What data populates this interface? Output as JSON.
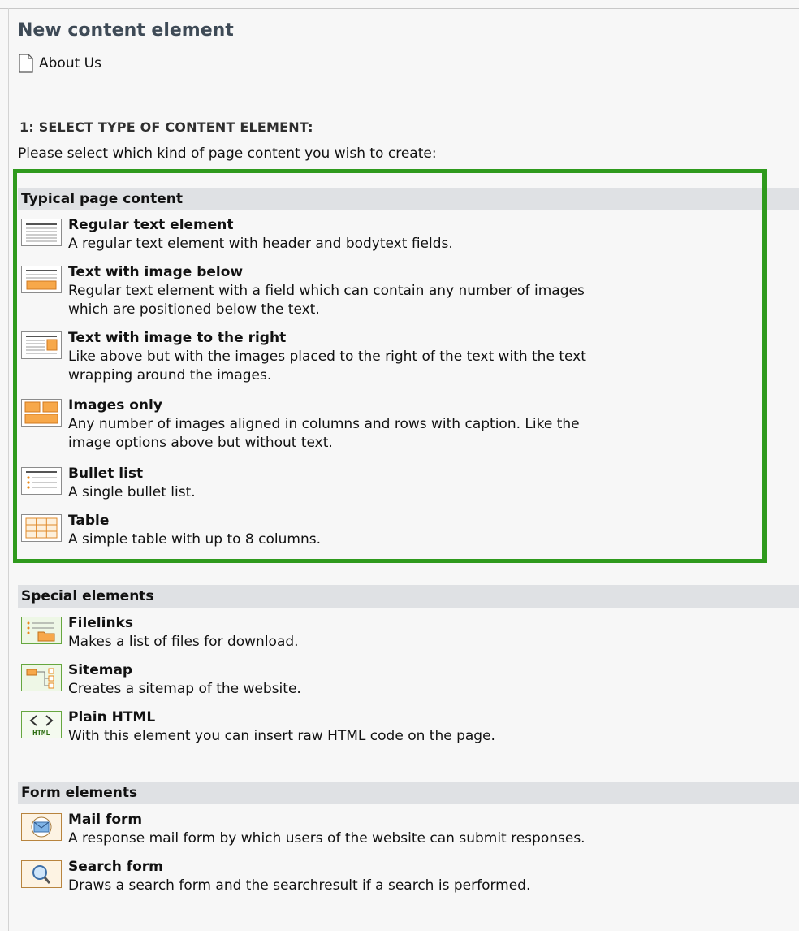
{
  "header": {
    "title": "New content element",
    "page_ref": "About Us",
    "step": "1: SELECT TYPE OF CONTENT ELEMENT:",
    "intro": "Please select which kind of page content you wish to create:"
  },
  "sections": {
    "typical": {
      "label": "Typical page content",
      "items": [
        {
          "name": "Regular text element",
          "desc": [
            "A regular text element with header and bodytext fields."
          ],
          "icon": "text-element-icon"
        },
        {
          "name": "Text with image below",
          "desc": [
            "Regular text element with a field which can contain any number of images",
            "which are positioned below the text."
          ],
          "icon": "text-image-below-icon"
        },
        {
          "name": "Text with image to the right",
          "desc": [
            "Like above but with the images placed to the right of the text with the text",
            "wrapping around the images."
          ],
          "icon": "text-image-right-icon"
        },
        {
          "name": "Images only",
          "desc": [
            "Any number of images aligned in columns and rows with caption. Like the",
            "image options above but without text."
          ],
          "icon": "images-only-icon"
        },
        {
          "name": "Bullet list",
          "desc": [
            "A single bullet list."
          ],
          "icon": "bullet-list-icon"
        },
        {
          "name": "Table",
          "desc": [
            "A simple table with up to 8 columns."
          ],
          "icon": "table-icon"
        }
      ]
    },
    "special": {
      "label": "Special elements",
      "items": [
        {
          "name": "Filelinks",
          "desc": [
            "Makes a list of files for download."
          ],
          "icon": "filelinks-icon"
        },
        {
          "name": "Sitemap",
          "desc": [
            "Creates a sitemap of the website."
          ],
          "icon": "sitemap-icon"
        },
        {
          "name": "Plain HTML",
          "desc": [
            "With this element you can insert raw HTML code on the page."
          ],
          "icon": "html-icon",
          "icon_text": "HTML"
        }
      ]
    },
    "form": {
      "label": "Form elements",
      "items": [
        {
          "name": "Mail form",
          "desc": [
            "A response mail form by which users of the website can submit responses."
          ],
          "icon": "mail-form-icon"
        },
        {
          "name": "Search form",
          "desc": [
            "Draws a search form and the searchresult if a search is performed."
          ],
          "icon": "search-form-icon"
        }
      ]
    }
  },
  "colors": {
    "highlight_border": "#2f9a1d",
    "section_header_bg": "#dfe1e4",
    "orange": "#f7a84a",
    "green": "#66a73f"
  }
}
